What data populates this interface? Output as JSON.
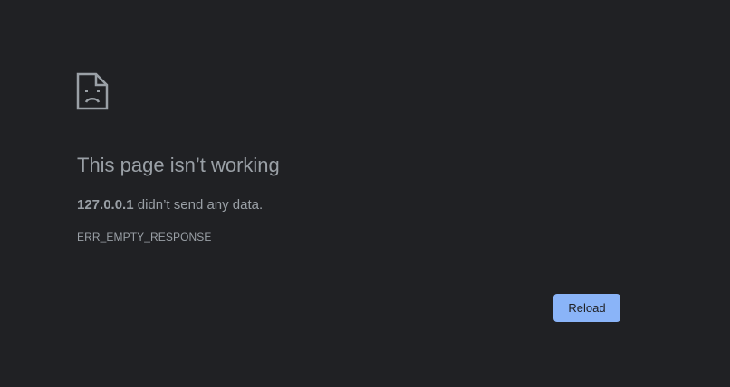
{
  "error_page": {
    "icon": "sad-file-icon",
    "title": "This page isn’t working",
    "host": "127.0.0.1",
    "message_suffix": " didn’t send any data.",
    "error_code": "ERR_EMPTY_RESPONSE",
    "reload_label": "Reload"
  },
  "colors": {
    "background": "#202124",
    "text": "#9aa0a6",
    "button": "#8ab4f8"
  }
}
